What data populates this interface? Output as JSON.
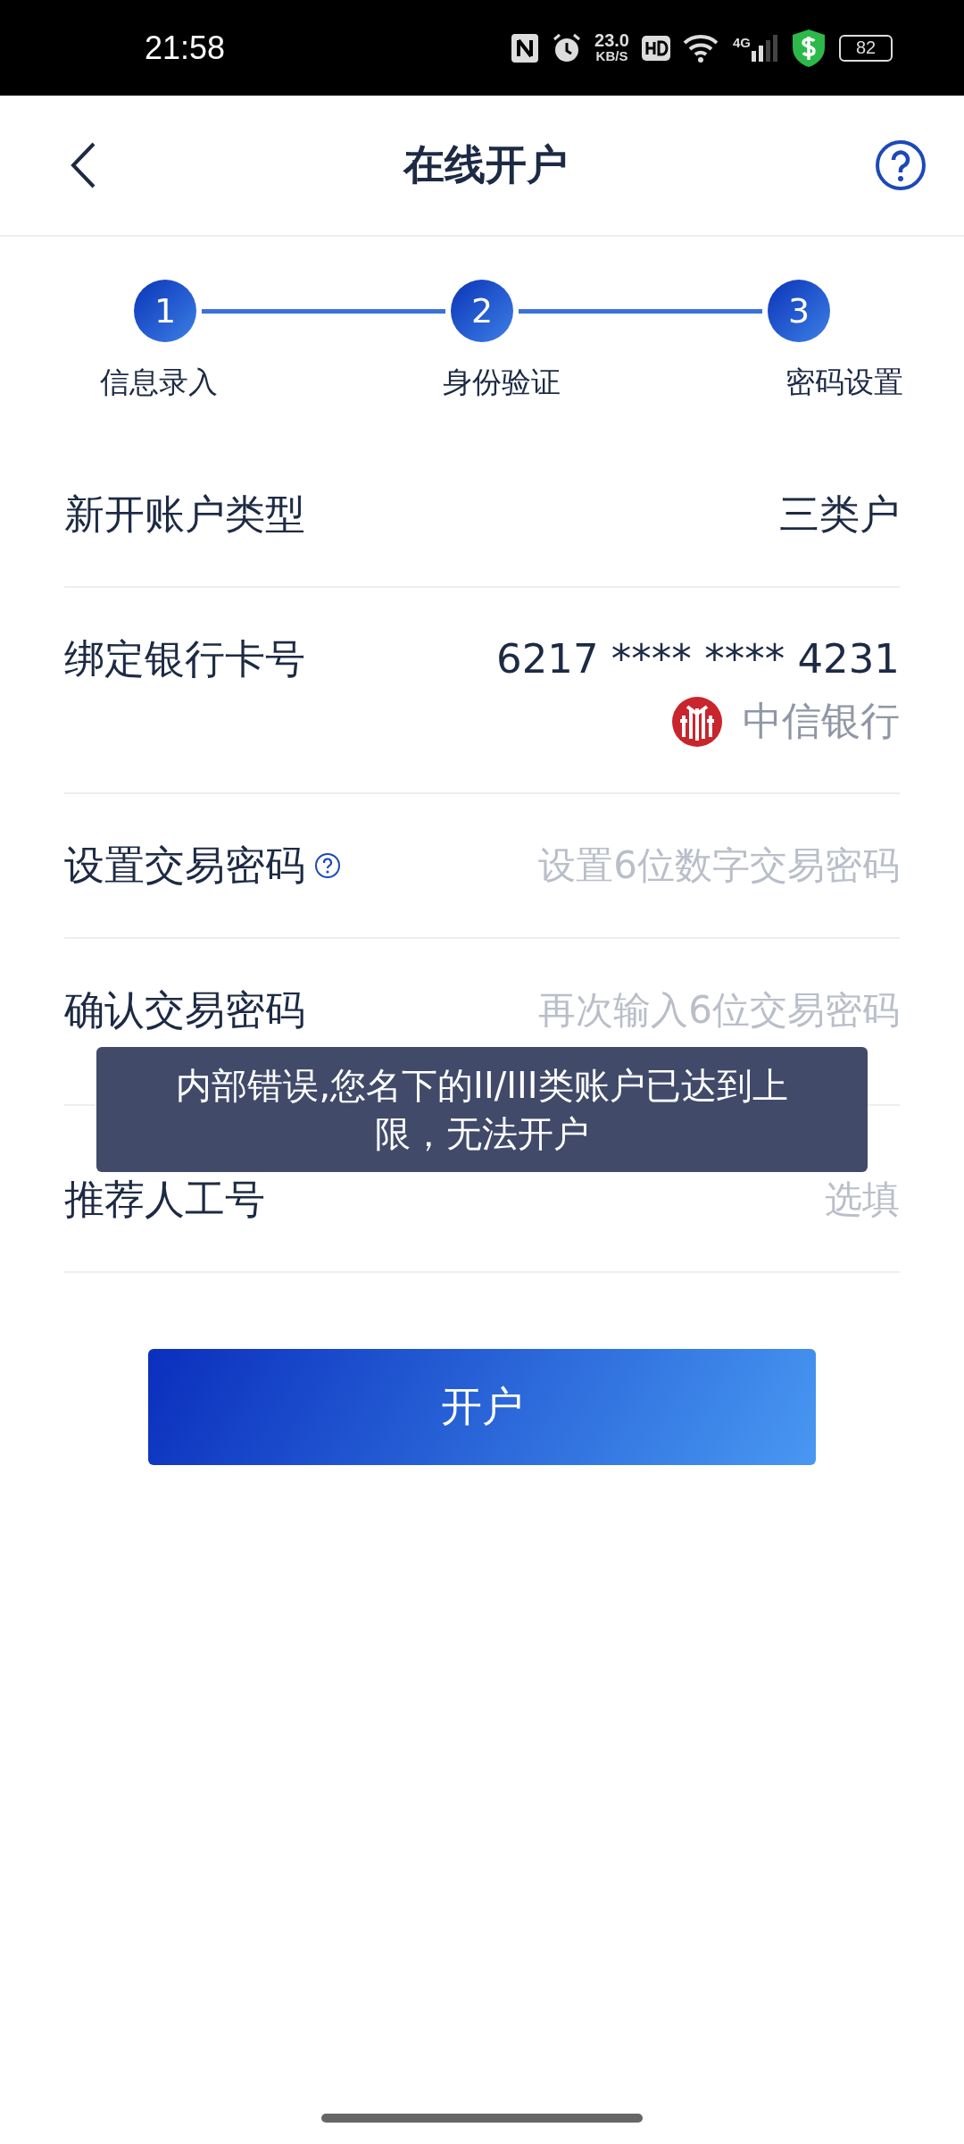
{
  "status_bar": {
    "time": "21:58",
    "speed_value": "23.0",
    "speed_unit": "KB/S",
    "network": "4G",
    "battery": "82"
  },
  "header": {
    "title": "在线开户"
  },
  "steps": [
    {
      "number": "1",
      "label": "信息录入",
      "selected": true
    },
    {
      "number": "2",
      "label": "身份验证",
      "selected": true
    },
    {
      "number": "3",
      "label": "密码设置",
      "selected": true
    }
  ],
  "rows": [
    {
      "kind": "value",
      "label": "新开账户类型",
      "value": "三类户"
    },
    {
      "kind": "card",
      "label": "绑定银行卡号",
      "value": "6217 **** **** 4231",
      "bank": "中信银行"
    },
    {
      "kind": "input",
      "label": "设置交易密码",
      "help": true,
      "placeholder": "设置6位数字交易密码"
    },
    {
      "kind": "input",
      "label": "确认交易密码",
      "help": false,
      "placeholder": "再次输入6位交易密码"
    },
    {
      "kind": "input",
      "label": "推荐人工号",
      "help": false,
      "placeholder": "选填"
    }
  ],
  "submit_button": "开户",
  "toast": "内部错误,您名下的II/III类账户已达到上限，无法开户"
}
